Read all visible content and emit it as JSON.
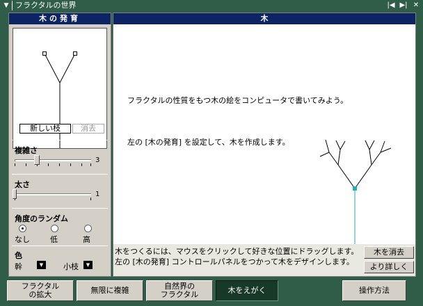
{
  "window": {
    "title": "フラクタルの世界",
    "menu_icon": "system-menu-icon",
    "controls": [
      "prev-icon",
      "next-icon",
      "close-icon"
    ]
  },
  "left_panel": {
    "header": "木の発育",
    "new_branch_label": "新しい枝",
    "erase_branch_label": "消去",
    "complexity": {
      "label": "複雑さ",
      "value": "3"
    },
    "thickness": {
      "label": "太さ",
      "value": "1"
    },
    "angle_random": {
      "label": "角度のランダム",
      "options": [
        "なし",
        "低",
        "高"
      ],
      "selected": "なし"
    },
    "color": {
      "label": "色",
      "trunk_label": "幹",
      "twig_label": "小枝"
    }
  },
  "main_panel": {
    "header": "木",
    "intro_line1": "フラクタルの性質をもつ木の絵をコンピュータで書いてみよう。",
    "intro_line2": "左の [木の発育] を設定して、木を作成します。",
    "instruction_line1": "木をつくるには、マウスをクリックして好きな位置にドラッグします。",
    "instruction_line2": "左の [木の発育] コントロールパネルをつかって木をデザインします。",
    "clear_tree_label": "木を消去",
    "more_detail_label": "より詳しく"
  },
  "bottom_nav": {
    "items": [
      {
        "line1": "フラクタル",
        "line2": "の拡大",
        "active": false
      },
      {
        "line1": "無限に複雑",
        "line2": "",
        "active": false
      },
      {
        "line1": "自然界の",
        "line2": "フラクタル",
        "active": false
      },
      {
        "line1": "木をえがく",
        "line2": "",
        "active": true
      }
    ],
    "help_label": "操作方法"
  },
  "colors": {
    "window_green": "#2f5d48",
    "header_navy": "#0c2464",
    "tree_trunk_teal": "#20b0b0",
    "active_tab": "#183828"
  }
}
